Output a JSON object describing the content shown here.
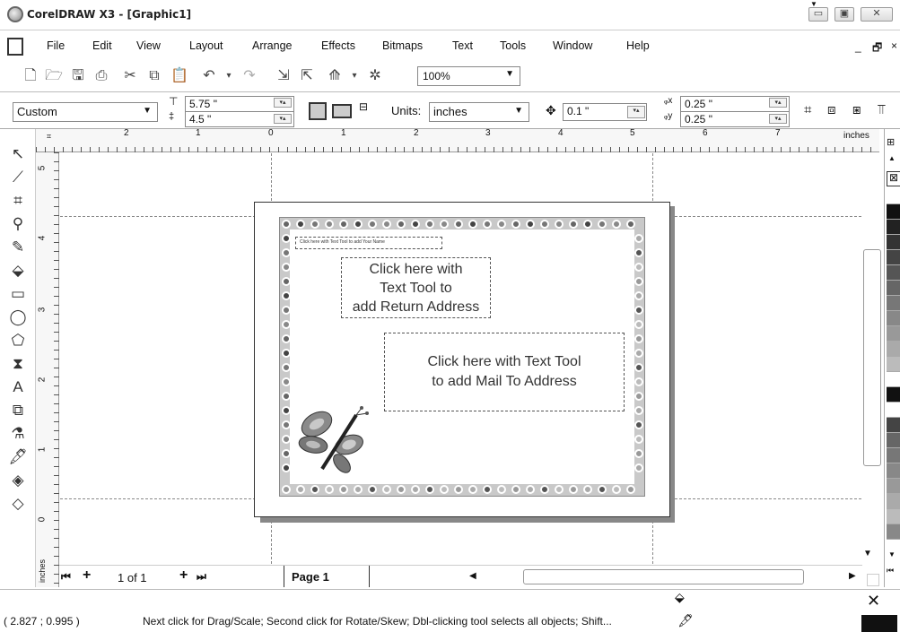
{
  "window": {
    "title": "CorelDRAW X3 - [Graphic1]",
    "controls": [
      "minimize",
      "maximize",
      "close"
    ],
    "doc_controls": [
      "minimize",
      "close"
    ]
  },
  "menubar": {
    "items": [
      "File",
      "Edit",
      "View",
      "Layout",
      "Arrange",
      "Effects",
      "Bitmaps",
      "Text",
      "Tools",
      "Window",
      "Help"
    ],
    "mnemonics": [
      "F",
      "E",
      "V",
      "L",
      "A",
      "c",
      "B",
      "T",
      "o",
      "W",
      "H"
    ]
  },
  "toolbar": {
    "zoom": "100%",
    "icons": [
      "new-icon",
      "open-icon",
      "save-icon",
      "print-icon",
      "cut-icon",
      "copy-icon",
      "paste-icon",
      "undo-icon",
      "redo-icon",
      "import-icon",
      "export-icon",
      "application-launcher-icon",
      "welcome-screen-icon"
    ]
  },
  "property_bar": {
    "page_size": "Custom",
    "width": "5.75 \"",
    "height": "4.5 \"",
    "units_label": "Units:",
    "units_value": "inches",
    "nudge": "0.1 \"",
    "dup_x": "0.25 \"",
    "dup_y": "0.25 \""
  },
  "rulers": {
    "units": "inches",
    "h_ticks": [
      "2",
      "1",
      "0",
      "1",
      "2",
      "3",
      "4",
      "5",
      "6",
      "7"
    ],
    "v_ticks": [
      "5",
      "4",
      "3",
      "2",
      "1",
      "0"
    ]
  },
  "document": {
    "name_frame": "Click here with Text Tool to add Your Name",
    "return_address": [
      "Click here with",
      "Text Tool to",
      "add Return Address"
    ],
    "mail_to": [
      "Click here with Text Tool",
      "to add Mail To Address"
    ]
  },
  "page_nav": {
    "counter": "1 of 1",
    "tab_label": "Page 1"
  },
  "status": {
    "coords": "( 2.827 ; 0.995 )",
    "message": "Next click for Drag/Scale; Second click for Rotate/Skew; Dbl-clicking tool selects all objects; Shift..."
  },
  "palette": {
    "colors": [
      "#ffffff",
      "#111111",
      "#222222",
      "#333333",
      "#444444",
      "#555555",
      "#666666",
      "#777777",
      "#888888",
      "#999999",
      "#aaaaaa",
      "#bbbbbb",
      "#ffffff",
      "#111111",
      "#ffffff",
      "#444444",
      "#666666",
      "#777777",
      "#888888",
      "#999999",
      "#aaaaaa",
      "#bbbbbb",
      "#888888"
    ]
  }
}
